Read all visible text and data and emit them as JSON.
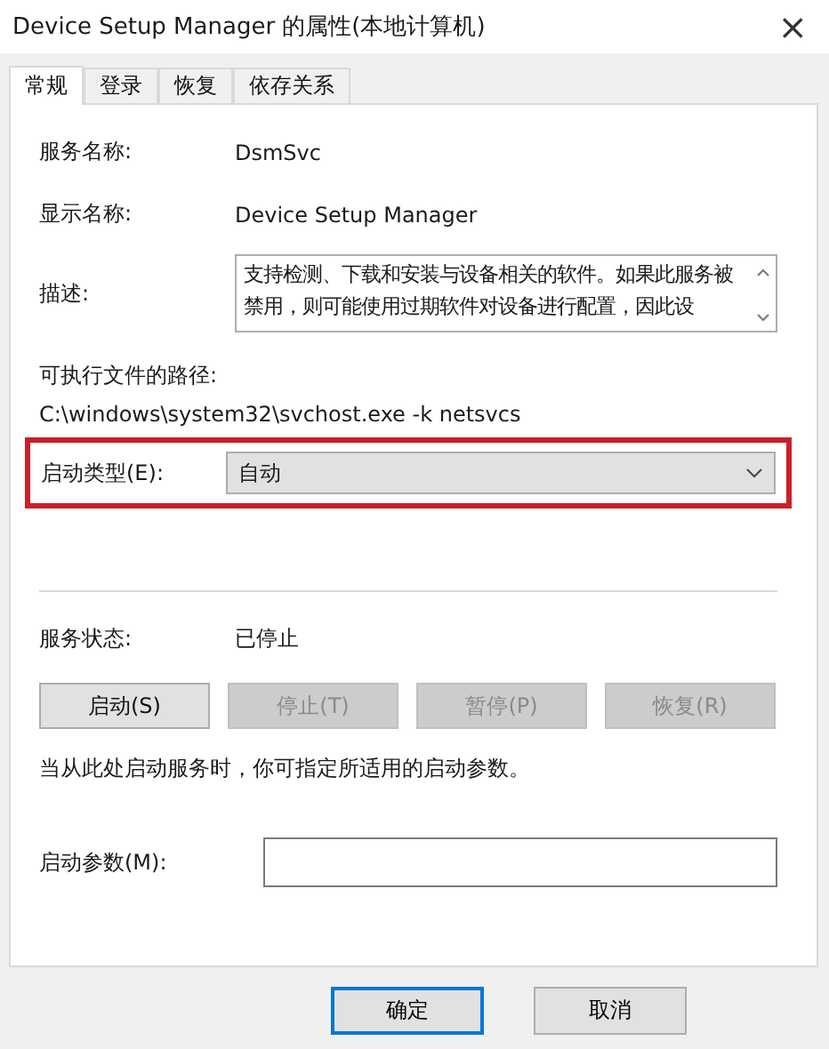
{
  "window": {
    "title": "Device Setup Manager 的属性(本地计算机)",
    "close": "×"
  },
  "tabs": [
    {
      "label": "常规",
      "selected": true
    },
    {
      "label": "登录",
      "selected": false
    },
    {
      "label": "恢复",
      "selected": false
    },
    {
      "label": "依存关系",
      "selected": false
    }
  ],
  "service_name": {
    "label": "服务名称:",
    "value": "DsmSvc"
  },
  "display_name": {
    "label": "显示名称:",
    "value": "Device Setup Manager"
  },
  "description": {
    "label": "描述:",
    "value": "支持检测、下载和安装与设备相关的软件。如果此服务被禁用，则可能使用过期软件对设备进行配置，因此设"
  },
  "path": {
    "label": "可执行文件的路径:",
    "value": "C:\\windows\\system32\\svchost.exe -k netsvcs"
  },
  "startup_type": {
    "label": "启动类型(E):",
    "value": "自动",
    "highlighted": true
  },
  "service_status": {
    "label": "服务状态:",
    "value": "已停止"
  },
  "service_buttons": [
    {
      "label": "启动(S)",
      "disabled": false
    },
    {
      "label": "停止(T)",
      "disabled": true
    },
    {
      "label": "暂停(P)",
      "disabled": true
    },
    {
      "label": "恢复(R)",
      "disabled": true
    }
  ],
  "hint": "当从此处启动服务时，你可指定所适用的启动参数。",
  "start_params": {
    "label": "启动参数(M):"
  },
  "dialog_buttons": [
    {
      "label": "确定",
      "default": true
    },
    {
      "label": "取消",
      "default": false
    }
  ]
}
